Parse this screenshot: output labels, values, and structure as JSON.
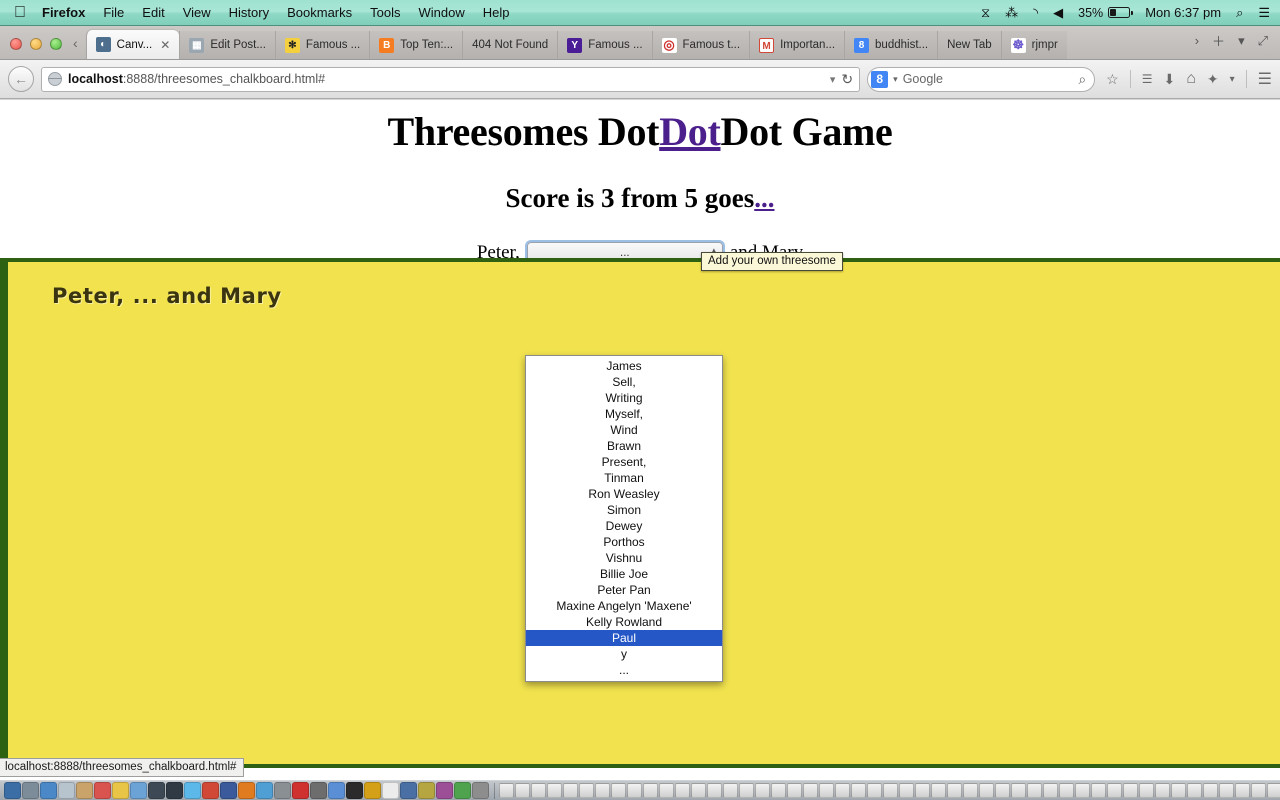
{
  "menubar": {
    "apple_icon": "apple-logo-icon",
    "items": [
      {
        "label": "Firefox",
        "bold": true
      },
      {
        "label": "File",
        "bold": false
      },
      {
        "label": "Edit",
        "bold": false
      },
      {
        "label": "View",
        "bold": false
      },
      {
        "label": "History",
        "bold": false
      },
      {
        "label": "Bookmarks",
        "bold": false
      },
      {
        "label": "Tools",
        "bold": false
      },
      {
        "label": "Window",
        "bold": false
      },
      {
        "label": "Help",
        "bold": false
      }
    ],
    "status": {
      "timemachine_icon": "⧖",
      "bluetooth_icon": "⁂",
      "wifi_icon": "◝",
      "volume_icon": "◀",
      "battery_percent": "35%",
      "clock": "Mon 6:37 pm",
      "search_icon": "⌕",
      "notifications_icon": "☰"
    }
  },
  "browser": {
    "tabs": [
      {
        "label": "Canv...",
        "favicon": "globe-icon",
        "color": "#4e6e8e",
        "glyph": "◔",
        "active": true
      },
      {
        "label": "Edit Post...",
        "favicon": "wordpress-icon",
        "color": "#9aa7b0",
        "glyph": "▦",
        "active": false
      },
      {
        "label": "Famous ...",
        "favicon": "bee-icon",
        "color": "#f4d03f",
        "glyph": "✻",
        "active": false
      },
      {
        "label": "Top Ten:...",
        "favicon": "blogger-icon",
        "color": "#f57c20",
        "glyph": "B",
        "active": false
      },
      {
        "label": "404 Not Found",
        "favicon": "none",
        "color": "transparent",
        "glyph": "",
        "active": false
      },
      {
        "label": "Famous ...",
        "favicon": "yahoo-icon",
        "color": "#4a1d96",
        "glyph": "Y",
        "active": false
      },
      {
        "label": "Famous t...",
        "favicon": "target-icon",
        "color": "#cf3030",
        "glyph": "◎",
        "active": false
      },
      {
        "label": "Importan...",
        "favicon": "gmail-icon",
        "color": "#ffffff",
        "glyph": "M",
        "active": false
      },
      {
        "label": "buddhist...",
        "favicon": "google-icon",
        "color": "#4285f4",
        "glyph": "8",
        "active": false
      },
      {
        "label": "New Tab",
        "favicon": "none",
        "color": "transparent",
        "glyph": "",
        "active": false
      },
      {
        "label": "rjmpr",
        "favicon": "spiral-icon",
        "color": "#8b7bd8",
        "glyph": "$",
        "active": false
      }
    ],
    "tab_close_icon": "✕",
    "tab_overflow_icon": "›",
    "new_tab_icon": "＋",
    "tab_list_icon": "▾",
    "fullscreen_icon": "⤢",
    "back_icon": "←",
    "url_host": "localhost",
    "url_rest": ":8888/threesomes_chalkboard.html#",
    "url_dropmarker": "▾",
    "reload_icon": "↻",
    "search_engine": "Google",
    "search_engine_glyph": "8",
    "search_dropmarker": "▾",
    "search_magnifier": "⌕",
    "toolbar_icons": [
      {
        "name": "bookmark-star-icon",
        "glyph": "☆"
      },
      {
        "name": "reader-list-icon",
        "glyph": "☰"
      },
      {
        "name": "downloads-icon",
        "glyph": "⬇"
      },
      {
        "name": "home-icon",
        "glyph": "⌂"
      },
      {
        "name": "addon-icon",
        "glyph": "✦"
      },
      {
        "name": "overflow-icon",
        "glyph": "▾"
      },
      {
        "name": "menu-hamburger-icon",
        "glyph": "☰"
      }
    ],
    "status_url": "localhost:8888/threesomes_chalkboard.html#"
  },
  "page": {
    "title_before": "Threesomes Dot",
    "title_link": "Dot",
    "title_after": "Dot Game",
    "tooltip": "Add your own threesome",
    "score_text": "Score is 3 from 5 goes",
    "score_link": "...",
    "chooser_prefix": "Peter,",
    "chooser_suffix": "and Mary",
    "select_value": "...",
    "select_arrow_up": "▴",
    "select_arrow_down": "▾",
    "chalkboard_text": "Peter, ... and Mary",
    "chalkboard_bg": "#f2e34e",
    "chalkboard_border": "#2e6112",
    "highlight_color": "#2557c7",
    "link_color": "#4b1f8c",
    "options": [
      {
        "label": "James",
        "selected": false
      },
      {
        "label": "Sell,",
        "selected": false
      },
      {
        "label": "Writing",
        "selected": false
      },
      {
        "label": "Myself,",
        "selected": false
      },
      {
        "label": "Wind",
        "selected": false
      },
      {
        "label": "Brawn",
        "selected": false
      },
      {
        "label": "Present,",
        "selected": false
      },
      {
        "label": "Tinman",
        "selected": false
      },
      {
        "label": "Ron Weasley",
        "selected": false
      },
      {
        "label": "Simon",
        "selected": false
      },
      {
        "label": "Dewey",
        "selected": false
      },
      {
        "label": "Porthos",
        "selected": false
      },
      {
        "label": "Vishnu",
        "selected": false
      },
      {
        "label": "Billie Joe",
        "selected": false
      },
      {
        "label": "Peter Pan",
        "selected": false
      },
      {
        "label": "Maxine Angelyn 'Maxene'",
        "selected": false
      },
      {
        "label": "Kelly Rowland",
        "selected": false
      },
      {
        "label": "Paul",
        "selected": true
      },
      {
        "label": "y",
        "selected": false
      },
      {
        "label": "...",
        "selected": false
      }
    ]
  },
  "dock": {
    "app_colors": [
      "#3b6ea5",
      "#7d8c99",
      "#4a88c7",
      "#b7c3cd",
      "#caa36b",
      "#d9534f",
      "#e8c547",
      "#6ba3d6",
      "#3d4a55",
      "#2f3a44",
      "#5bb8e8",
      "#d14836",
      "#3a5a9b",
      "#e07b20",
      "#4f9fd4",
      "#8a8f94",
      "#cf3030",
      "#6d6d6d",
      "#5a8fd6",
      "#2b2b2b",
      "#d4a017",
      "#ececec",
      "#4a6fa5",
      "#b5a642",
      "#9c4f96",
      "#4fa34f",
      "#8d8d8d"
    ]
  }
}
